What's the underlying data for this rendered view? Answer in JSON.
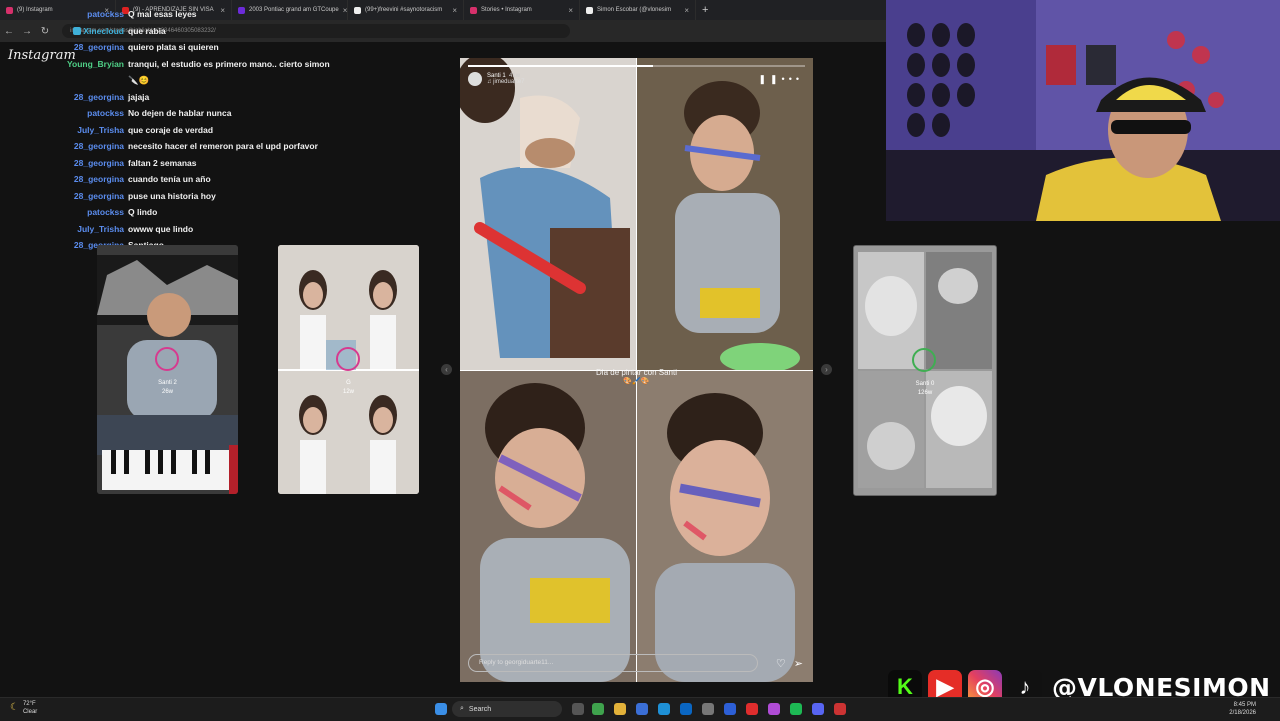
{
  "browser": {
    "tabs": [
      {
        "label": "(9) Instagram",
        "color": "#d6306b"
      },
      {
        "label": "(9) - APRENDIZAJE SIN VISA",
        "color": "#d22"
      },
      {
        "label": "2003 Pontiac grand am GTCoupe",
        "color": "#6c2bd9"
      },
      {
        "label": "(99+)freevini #saynotoracism",
        "color": "#eee"
      },
      {
        "label": "Stories • Instagram",
        "color": "#d6306b"
      },
      {
        "label": "Simon Escobar (@vlonesim",
        "color": "#eee"
      }
    ],
    "new_tab": "+",
    "url": "instagram.com/stories/highlights/18346460305083232/"
  },
  "instagram_logo": "Instagram",
  "chat": [
    {
      "user": "patockss",
      "text": "Q mal esas leyes",
      "color": "#5b8def"
    },
    {
      "user": "Xinecloud",
      "text": "que rabia",
      "color": "#3fb0d8",
      "badge": true
    },
    {
      "user": "28_georgina",
      "text": "quiero plata si quieren",
      "color": "#5b8def"
    },
    {
      "user": "Young_Bryian",
      "text": "tranqui, el estudio es primero mano.. cierto simon",
      "color": "#4fd087"
    },
    {
      "user": "",
      "text": "🔪😊",
      "color": "#fff"
    },
    {
      "user": "28_georgina",
      "text": "jajaja",
      "color": "#5b8def"
    },
    {
      "user": "patockss",
      "text": "No dejen de hablar nunca",
      "color": "#5b8def"
    },
    {
      "user": "July_Trisha",
      "text": "que coraje de verdad",
      "color": "#5b8def"
    },
    {
      "user": "28_georgina",
      "text": "necesito hacer el remeron para el upd porfavor",
      "color": "#5b8def"
    },
    {
      "user": "28_georgina",
      "text": "faltan 2 semanas",
      "color": "#5b8def"
    },
    {
      "user": "28_georgina",
      "text": "cuando tenía un año",
      "color": "#5b8def"
    },
    {
      "user": "28_georgina",
      "text": "puse una historia hoy",
      "color": "#5b8def"
    },
    {
      "user": "patockss",
      "text": "Q lindo",
      "color": "#5b8def"
    },
    {
      "user": "July_Trisha",
      "text": "owww que lindo",
      "color": "#5b8def"
    },
    {
      "user": "28_georgina",
      "text": "Santiago",
      "color": "#5b8def"
    }
  ],
  "cards": {
    "left1": {
      "name": "Santi 2",
      "time": "26w"
    },
    "left2": {
      "name": "G",
      "time": "12w"
    },
    "right1": {
      "name": "Santi 0",
      "time": "126w"
    }
  },
  "story": {
    "user": "Santi 1",
    "time": "41w",
    "audio": "jimeduarte7",
    "caption": "Dia de pintar con Santi",
    "caption_emoji": "🎨🖌️🎨",
    "reply_placeholder": "Reply to georgiduarte11...",
    "progress": 0.55
  },
  "social": {
    "handle": "@VLONESIMON",
    "icons": [
      "kick-icon",
      "youtube-icon",
      "instagram-icon",
      "tiktok-icon"
    ]
  },
  "taskbar": {
    "weather_temp": "72°F",
    "weather_desc": "Clear",
    "search": "Search",
    "time": "8:45 PM",
    "date": "2/18/2026"
  }
}
